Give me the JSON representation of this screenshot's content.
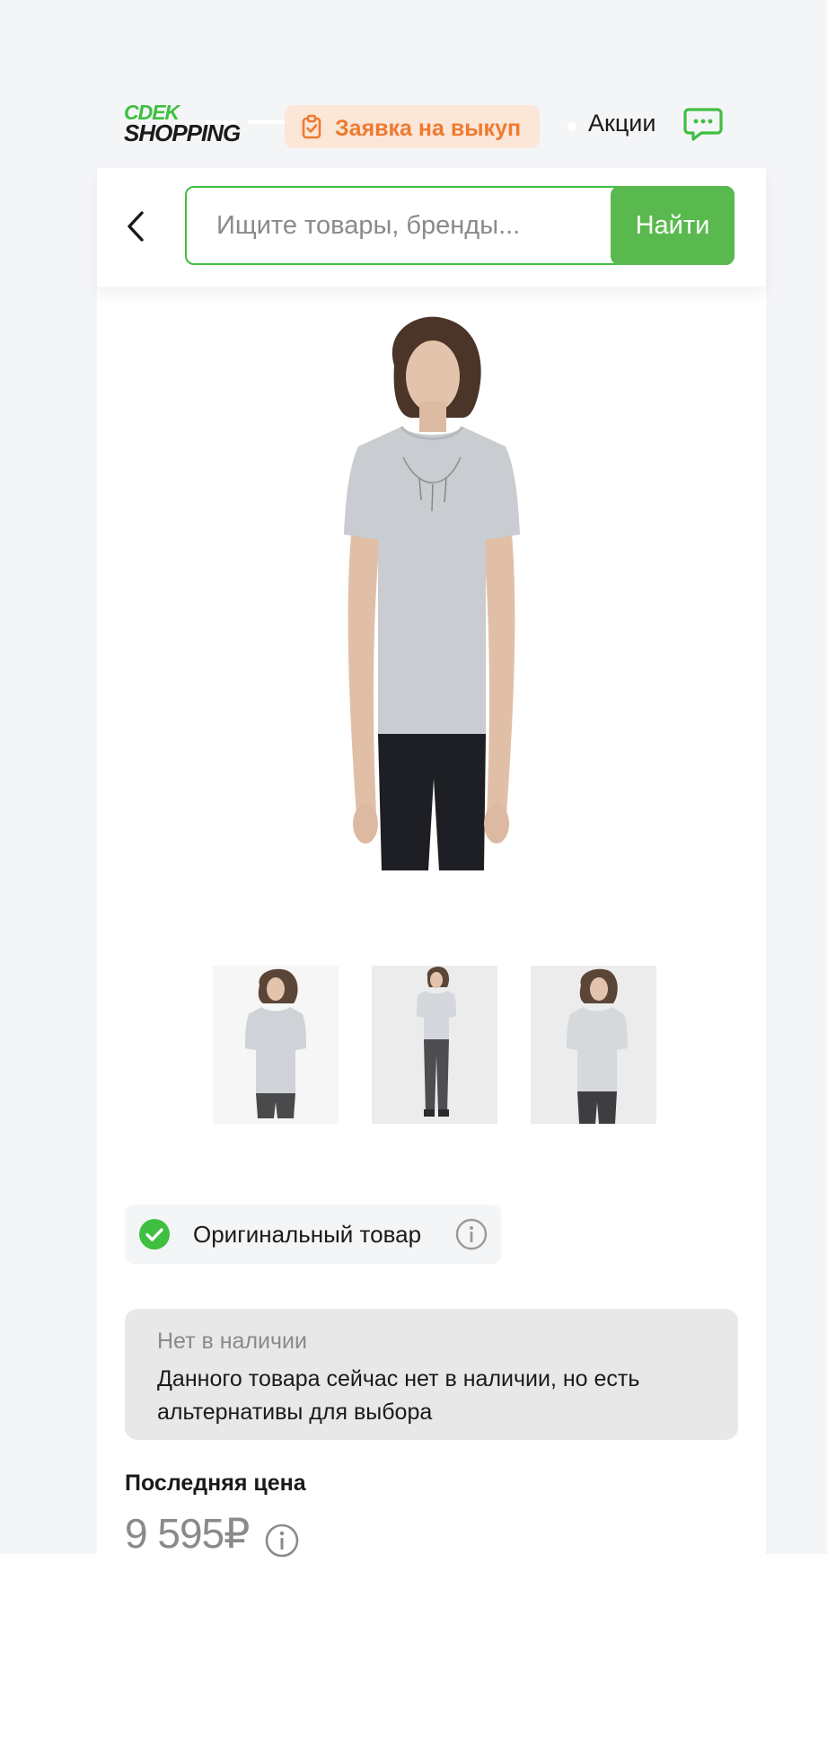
{
  "header": {
    "logo": {
      "line1": "CDEK",
      "line2": "SHOPPING"
    },
    "buyout_button": "Заявка на выкуп",
    "promo_link": "Акции",
    "chat_icon": "chat-bubble-icon"
  },
  "search": {
    "back_icon": "chevron-left-icon",
    "placeholder": "Ищите товары, бренды...",
    "button_label": "Найти"
  },
  "product": {
    "main_image_alt": "product-photo-main",
    "thumbnails": [
      "thumbnail-1",
      "thumbnail-2",
      "thumbnail-3"
    ],
    "original_badge": "Оригинальный товар",
    "availability": {
      "title": "Нет в наличии",
      "text": "Данного товара сейчас нет в наличии, но есть альтернативы для выбора"
    },
    "last_price_label": "Последняя цена",
    "price": "9 595₽"
  },
  "colors": {
    "brand_green": "#3fbf3f",
    "button_green": "#5ab94e",
    "buyout_orange": "#ee7a2f",
    "buyout_bg": "#fbe6d8",
    "page_bg": "#f4f5f7"
  }
}
